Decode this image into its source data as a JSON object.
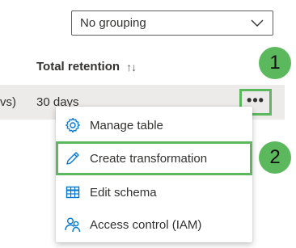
{
  "grouping": {
    "value": "No grouping"
  },
  "table": {
    "column_header": "Total retention",
    "sort_indicator": "↑↓",
    "row": {
      "left_fragment": "vs)",
      "retention": "30 days"
    },
    "more_label": "•••"
  },
  "menu": {
    "items": [
      {
        "label": "Manage table",
        "icon": "gear-icon"
      },
      {
        "label": "Create transformation",
        "icon": "pencil-icon"
      },
      {
        "label": "Edit schema",
        "icon": "table-icon"
      },
      {
        "label": "Access control (IAM)",
        "icon": "people-icon"
      }
    ]
  },
  "callouts": [
    "1",
    "2"
  ],
  "colors": {
    "callout": "#5cb85c",
    "icon_blue": "#0078d4",
    "row_bg": "#edebe9"
  }
}
